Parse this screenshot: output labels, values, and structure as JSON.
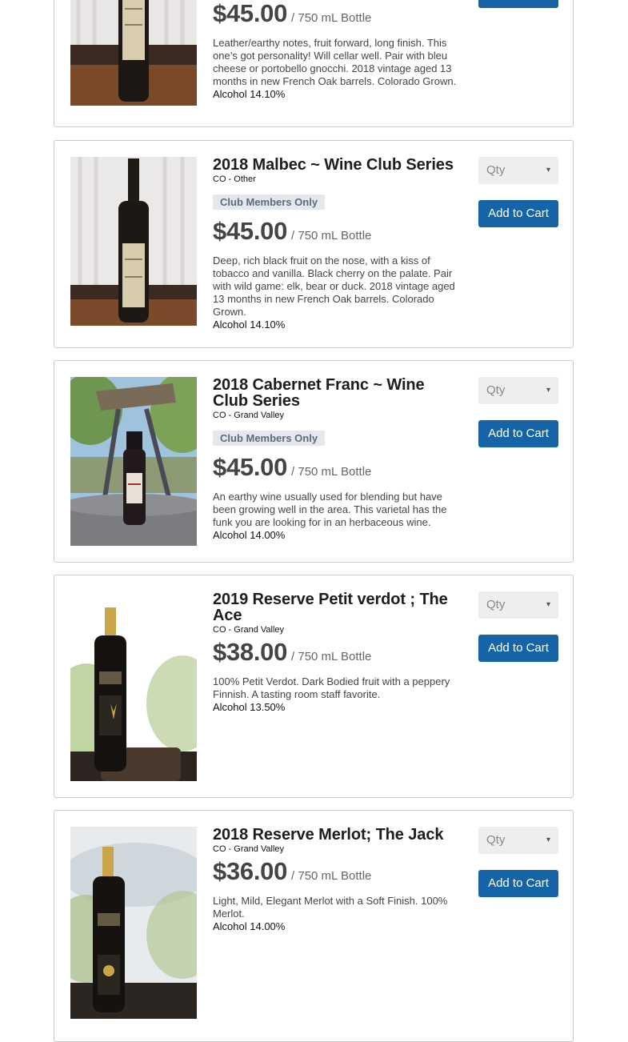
{
  "ui": {
    "qty_placeholder": "Qty",
    "add_to_cart": "Add to Cart",
    "caret": "▾"
  },
  "products": [
    {
      "title": "",
      "region": "",
      "badge": "",
      "price": "$45.00",
      "unit": "/ 750 mL Bottle",
      "description": "Leather/earthy notes, fruit forward, long finish. This one’s got personality! Will cellar well. Pair with bleu cheese or portobello gnocchi. 2018 vintage aged 13 months in new French Oak barrels. Colorado Grown.",
      "alcohol": "Alcohol 14.10%"
    },
    {
      "title": "2018 Malbec ~ Wine Club Series",
      "region": "CO - Other",
      "badge": "Club Members Only",
      "price": "$45.00",
      "unit": "/ 750 mL Bottle",
      "description": "Deep, rich black fruit on the nose, with a kiss of tobacco and vanilla. Black cherry on the palate. Pair with wild game: elk, bear or duck. 2018 vintage aged 13 months in new French Oak barrels. Colorado Grown.",
      "alcohol": "Alcohol 14.10%"
    },
    {
      "title": "2018 Cabernet Franc ~ Wine Club Series",
      "region": "CO - Grand Valley",
      "badge": "Club Members Only",
      "price": "$45.00",
      "unit": "/ 750 mL Bottle",
      "description": "An earthy wine usually used for blending but have been growing well in the area. This varietal has the funk you are looking for in an herbaceous wine.",
      "alcohol": "Alcohol 14.00%"
    },
    {
      "title": "2019 Reserve Petit verdot ; The Ace",
      "region": "CO - Grand Valley",
      "badge": "",
      "price": "$38.00",
      "unit": "/ 750 mL Bottle",
      "description": "100% Petit Verdot. Dark Bodied fruit with a peppery Finnish. A tasting room staff favorite.",
      "alcohol": "Alcohol 13.50%"
    },
    {
      "title": "2018 Reserve Merlot; The Jack",
      "region": "CO - Grand Valley",
      "badge": "",
      "price": "$36.00",
      "unit": "/ 750 mL Bottle",
      "description": "Light, Mild, Elegant Merlot with a Soft Finish. 100% Merlot.",
      "alcohol": "Alcohol 14.00%"
    }
  ]
}
